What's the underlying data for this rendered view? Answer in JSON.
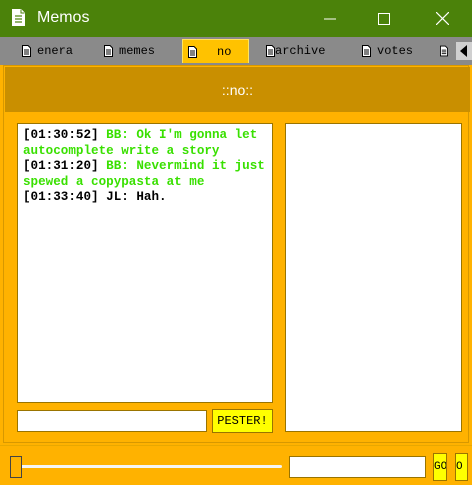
{
  "window": {
    "title": "Memos",
    "icon": "document-icon",
    "controls": [
      "minimize",
      "maximize",
      "close"
    ]
  },
  "tabs": [
    {
      "label": "enera",
      "icon": "document-icon",
      "active": false
    },
    {
      "label": "memes",
      "icon": "document-icon",
      "active": false
    },
    {
      "label": "no",
      "icon": "document-icon",
      "active": true
    },
    {
      "label": "archive",
      "icon": "document-icon",
      "active": false
    },
    {
      "label": "votes",
      "icon": "document-icon",
      "active": false
    }
  ],
  "memo": {
    "title": "::no::",
    "log": [
      {
        "time": "[01:30:52]",
        "text": "BB: Ok I'm gonna let autocomplete write a story",
        "color": "#39e000"
      },
      {
        "time": "[01:31:20]",
        "text": "BB: Nevermind it just spewed a copypasta at me",
        "color": "#39e000"
      },
      {
        "time": "[01:33:40]",
        "text": "JL: Hah.",
        "color": "#000000"
      }
    ],
    "input_value": "",
    "pester_label": "PESTER!"
  },
  "timeline": {
    "time_value": "",
    "go_label": "GO",
    "o_label": "O"
  },
  "colors": {
    "titlebar": "#4b820a",
    "background": "#ffb200",
    "header": "#c98f00",
    "button": "#ffff00",
    "bb_text": "#39e000"
  }
}
